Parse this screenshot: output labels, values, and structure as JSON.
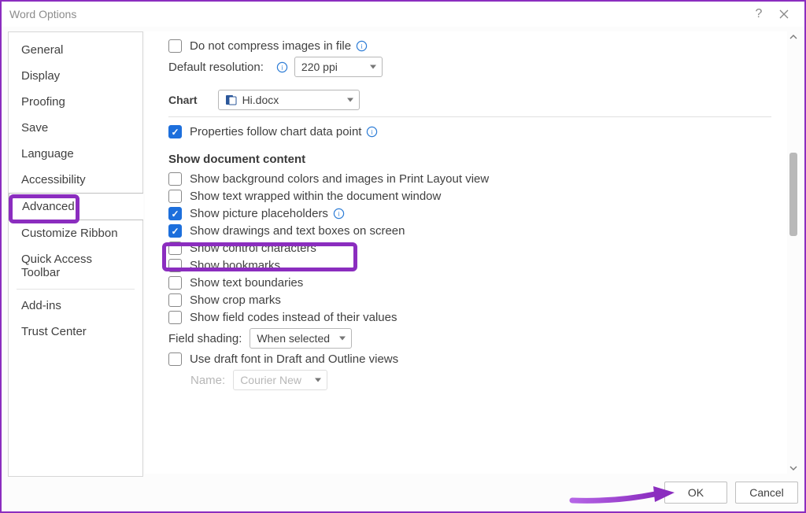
{
  "window": {
    "title": "Word Options",
    "help_label": "?",
    "close_label": "Close"
  },
  "sidebar": {
    "items": [
      {
        "label": "General"
      },
      {
        "label": "Display"
      },
      {
        "label": "Proofing"
      },
      {
        "label": "Save"
      },
      {
        "label": "Language"
      },
      {
        "label": "Accessibility"
      },
      {
        "label": "Advanced",
        "active": true
      },
      {
        "label": "Customize Ribbon"
      },
      {
        "label": "Quick Access Toolbar"
      },
      {
        "label": "Add-ins",
        "sep_before": true
      },
      {
        "label": "Trust Center"
      }
    ]
  },
  "content": {
    "compress_label": "Do not compress images in file",
    "default_res_label": "Default resolution:",
    "default_res_value": "220 ppi",
    "chart_label": "Chart",
    "chart_doc": "Hi.docx",
    "props_follow_label": "Properties follow chart data point",
    "sdc_head": "Show document content",
    "opts": {
      "bg": "Show background colors and images in Print Layout view",
      "wrap": "Show text wrapped within the document window",
      "placeholders": "Show picture placeholders",
      "drawings": "Show drawings and text boxes on screen",
      "ctrl": "Show control characters",
      "bookmarks": "Show bookmarks",
      "bounds": "Show text boundaries",
      "crop": "Show crop marks",
      "fieldcodes": "Show field codes instead of their values",
      "field_shading_label": "Field shading:",
      "field_shading_value": "When selected",
      "draft_font": "Use draft font in Draft and Outline views",
      "name_label": "Name:",
      "name_value": "Courier New"
    }
  },
  "footer": {
    "ok": "OK",
    "cancel": "Cancel"
  }
}
